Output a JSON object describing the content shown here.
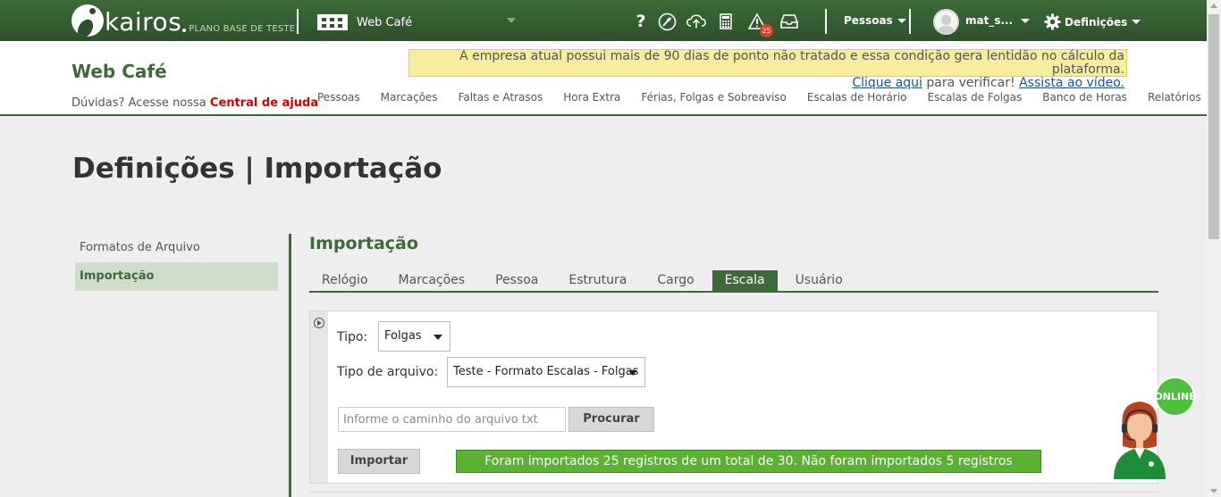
{
  "topbar": {
    "logo_text": "kairos",
    "plan": "PLANO BASE DE TESTE",
    "company": "Web Café",
    "alerts_count": "25",
    "people_menu": "Pessoas",
    "user": "mat_s...",
    "settings_menu": "Definições",
    "help_icon": "?"
  },
  "header": {
    "brand": "Web Café",
    "help_prefix": "Dúvidas? Acesse nossa ",
    "help_link": "Central de ajuda",
    "alert_text": "A empresa atual possui mais de 90 dias de ponto não tratado e essa condição gera lentidão no cálculo da plataforma.",
    "alert_link1": "Clique aqui",
    "alert_middle": " para verificar! ",
    "alert_link2": "Assista ao vídeo."
  },
  "nav": [
    "Pessoas",
    "Marcações",
    "Faltas e Atrasos",
    "Hora Extra",
    "Férias, Folgas e Sobreaviso",
    "Escalas de Horário",
    "Escalas de Folgas",
    "Banco de Horas",
    "Relatórios"
  ],
  "page": {
    "title": "Definições | Importação",
    "sidebar": [
      "Formatos de Arquivo",
      "Importação"
    ],
    "section_title": "Importação",
    "tabs": [
      "Relógio",
      "Marcações",
      "Pessoa",
      "Estrutura",
      "Cargo",
      "Escala",
      "Usuário"
    ],
    "active_tab": "Escala"
  },
  "form": {
    "tipo_label": "Tipo:",
    "tipo_value": "Folgas",
    "arquivo_label": "Tipo de arquivo:",
    "arquivo_value": "Teste - Formato Escalas - Folgas",
    "file_placeholder": "Informe o caminho do arquivo txt",
    "browse_label": "Procurar",
    "import_label": "Importar",
    "result_message": "Foram importados 25 registros de um total de 30. Não foram importados 5 registros"
  },
  "assistant": {
    "status": "ONLINE"
  },
  "colors": {
    "brand_green": "#3e6a3a",
    "result_green": "#5cb034",
    "alert_bg": "#f8ec9e",
    "help_red": "#d40000"
  }
}
